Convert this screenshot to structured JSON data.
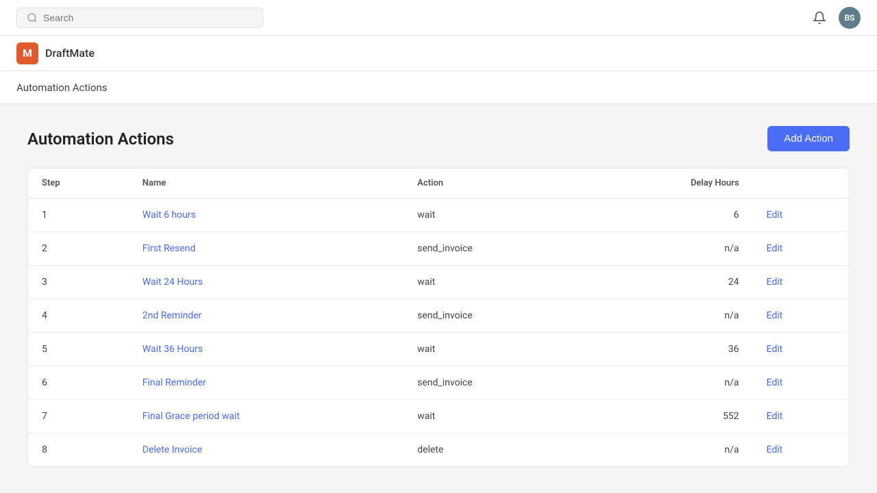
{
  "navbar": {
    "search_placeholder": "Search",
    "avatar_initials": "BS"
  },
  "brand": {
    "logo_letter": "M",
    "name": "DraftMate"
  },
  "breadcrumb": {
    "text": "Automation Actions"
  },
  "page": {
    "title": "Automation Actions",
    "add_button_label": "Add Action"
  },
  "table": {
    "columns": [
      "Step",
      "Name",
      "Action",
      "Delay Hours"
    ],
    "rows": [
      {
        "step": "1",
        "name": "Wait 6 hours",
        "action": "wait",
        "delay_hours": "6"
      },
      {
        "step": "2",
        "name": "First Resend",
        "action": "send_invoice",
        "delay_hours": "n/a"
      },
      {
        "step": "3",
        "name": "Wait 24 Hours",
        "action": "wait",
        "delay_hours": "24"
      },
      {
        "step": "4",
        "name": "2nd Reminder",
        "action": "send_invoice",
        "delay_hours": "n/a"
      },
      {
        "step": "5",
        "name": "Wait 36 Hours",
        "action": "wait",
        "delay_hours": "36"
      },
      {
        "step": "6",
        "name": "Final Reminder",
        "action": "send_invoice",
        "delay_hours": "n/a"
      },
      {
        "step": "7",
        "name": "Final Grace period wait",
        "action": "wait",
        "delay_hours": "552"
      },
      {
        "step": "8",
        "name": "Delete Invoice",
        "action": "delete",
        "delay_hours": "n/a"
      }
    ],
    "edit_label": "Edit"
  },
  "colors": {
    "accent": "#4a6cf7",
    "brand_logo": "#e05a2b"
  }
}
